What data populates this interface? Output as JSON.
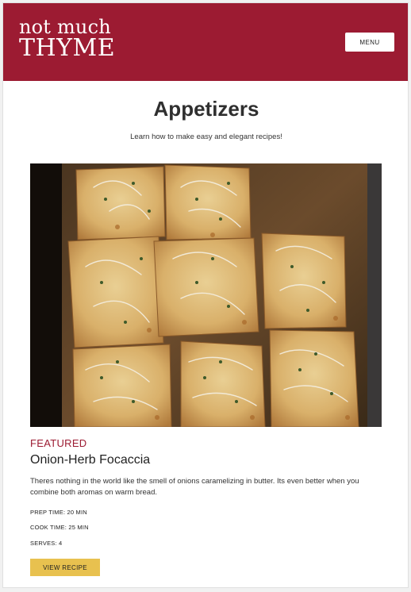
{
  "header": {
    "logo_line1": "not much",
    "logo_line2": "THYME",
    "menu_label": "MENU"
  },
  "page": {
    "title": "Appetizers",
    "subtitle": "Learn how to make easy and elegant recipes!"
  },
  "featured": {
    "tag": "FEATURED",
    "recipe_title": "Onion-Herb Focaccia",
    "description": "Theres nothing in the world like the smell of onions caramelizing in butter. Its even better when you combine both aromas on warm bread.",
    "prep_time": "PREP TIME: 20 MIN",
    "cook_time": "COOK TIME: 25 MIN",
    "serves": "SERVES: 4",
    "button_label": "VIEW RECIPE",
    "image_icon": "focaccia-photo"
  },
  "colors": {
    "brand": "#9c1b32",
    "button": "#e8c14f"
  }
}
